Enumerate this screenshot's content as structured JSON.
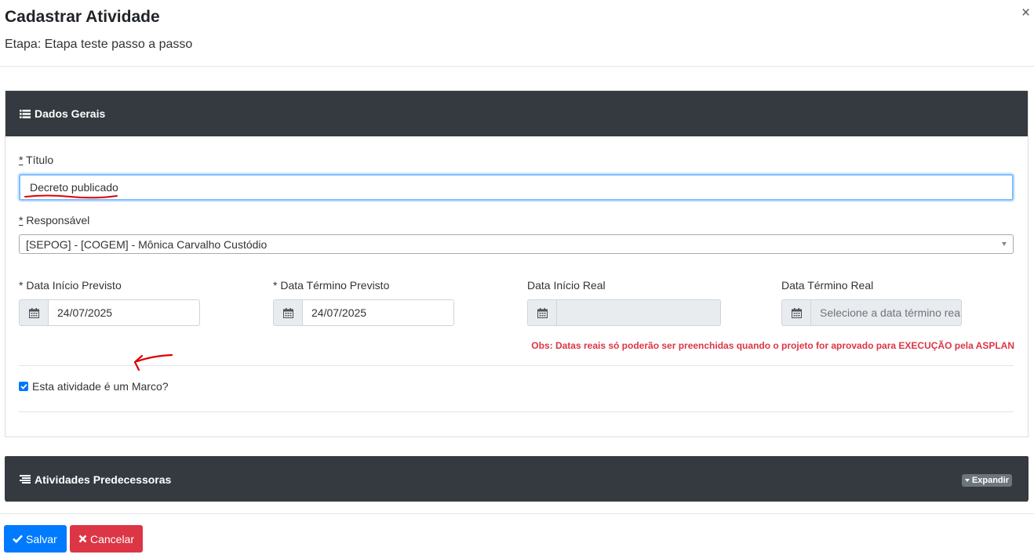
{
  "modal": {
    "title": "Cadastrar Atividade",
    "subtitle": "Etapa: Etapa teste passo a passo",
    "close": "×"
  },
  "dados_gerais": {
    "header": "Dados Gerais",
    "titulo": {
      "required_mark": "*",
      "label": " Título",
      "value": "Decreto publicado"
    },
    "responsavel": {
      "required_mark": "*",
      "label": " Responsável",
      "value": "[SEPOG] - [COGEM] - Mônica Carvalho Custódio"
    },
    "data_inicio_previsto": {
      "label": "* Data Início Previsto",
      "value": "24/07/2025"
    },
    "data_termino_previsto": {
      "label": "* Data Término Previsto",
      "value": "24/07/2025"
    },
    "data_inicio_real": {
      "label": "Data Início Real",
      "value": ""
    },
    "data_termino_real": {
      "label": "Data Término Real",
      "placeholder": "Selecione a data término real"
    },
    "obs": "Obs: Datas reais só poderão ser preenchidas quando o projeto for aprovado para EXECUÇÃO pela ASPLAN",
    "marco": {
      "label": "Esta atividade é um Marco?",
      "checked": true
    }
  },
  "atividades_predecessoras": {
    "header": "Atividades Predecessoras",
    "expand_label": "Expandir"
  },
  "footer": {
    "save_label": "Salvar",
    "cancel_label": "Cancelar"
  },
  "colors": {
    "header_bg": "#343a40",
    "primary": "#007bff",
    "danger": "#dc3545",
    "annotation": "#e00000"
  }
}
